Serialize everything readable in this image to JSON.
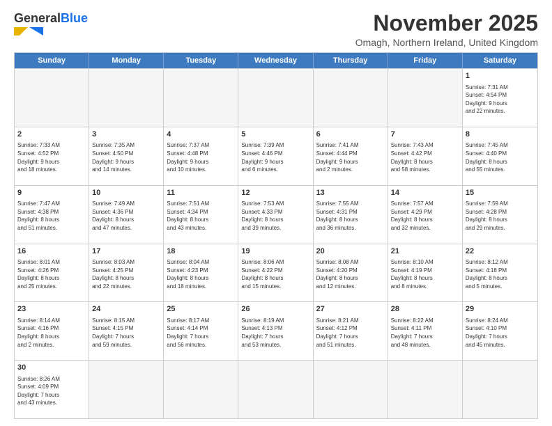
{
  "header": {
    "logo_general": "General",
    "logo_blue": "Blue",
    "title": "November 2025",
    "subtitle": "Omagh, Northern Ireland, United Kingdom"
  },
  "days": [
    "Sunday",
    "Monday",
    "Tuesday",
    "Wednesday",
    "Thursday",
    "Friday",
    "Saturday"
  ],
  "weeks": [
    [
      {
        "day": "",
        "empty": true
      },
      {
        "day": "",
        "empty": true
      },
      {
        "day": "",
        "empty": true
      },
      {
        "day": "",
        "empty": true
      },
      {
        "day": "",
        "empty": true
      },
      {
        "day": "",
        "empty": true
      },
      {
        "day": "1",
        "sunrise": "Sunrise: 7:31 AM",
        "sunset": "Sunset: 4:54 PM",
        "daylight": "Daylight: 9 hours",
        "daylight2": "and 22 minutes."
      }
    ],
    [
      {
        "day": "2",
        "sunrise": "Sunrise: 7:33 AM",
        "sunset": "Sunset: 4:52 PM",
        "daylight": "Daylight: 9 hours",
        "daylight2": "and 18 minutes."
      },
      {
        "day": "3",
        "sunrise": "Sunrise: 7:35 AM",
        "sunset": "Sunset: 4:50 PM",
        "daylight": "Daylight: 9 hours",
        "daylight2": "and 14 minutes."
      },
      {
        "day": "4",
        "sunrise": "Sunrise: 7:37 AM",
        "sunset": "Sunset: 4:48 PM",
        "daylight": "Daylight: 9 hours",
        "daylight2": "and 10 minutes."
      },
      {
        "day": "5",
        "sunrise": "Sunrise: 7:39 AM",
        "sunset": "Sunset: 4:46 PM",
        "daylight": "Daylight: 9 hours",
        "daylight2": "and 6 minutes."
      },
      {
        "day": "6",
        "sunrise": "Sunrise: 7:41 AM",
        "sunset": "Sunset: 4:44 PM",
        "daylight": "Daylight: 9 hours",
        "daylight2": "and 2 minutes."
      },
      {
        "day": "7",
        "sunrise": "Sunrise: 7:43 AM",
        "sunset": "Sunset: 4:42 PM",
        "daylight": "Daylight: 8 hours",
        "daylight2": "and 58 minutes."
      },
      {
        "day": "8",
        "sunrise": "Sunrise: 7:45 AM",
        "sunset": "Sunset: 4:40 PM",
        "daylight": "Daylight: 8 hours",
        "daylight2": "and 55 minutes."
      }
    ],
    [
      {
        "day": "9",
        "sunrise": "Sunrise: 7:47 AM",
        "sunset": "Sunset: 4:38 PM",
        "daylight": "Daylight: 8 hours",
        "daylight2": "and 51 minutes."
      },
      {
        "day": "10",
        "sunrise": "Sunrise: 7:49 AM",
        "sunset": "Sunset: 4:36 PM",
        "daylight": "Daylight: 8 hours",
        "daylight2": "and 47 minutes."
      },
      {
        "day": "11",
        "sunrise": "Sunrise: 7:51 AM",
        "sunset": "Sunset: 4:34 PM",
        "daylight": "Daylight: 8 hours",
        "daylight2": "and 43 minutes."
      },
      {
        "day": "12",
        "sunrise": "Sunrise: 7:53 AM",
        "sunset": "Sunset: 4:33 PM",
        "daylight": "Daylight: 8 hours",
        "daylight2": "and 39 minutes."
      },
      {
        "day": "13",
        "sunrise": "Sunrise: 7:55 AM",
        "sunset": "Sunset: 4:31 PM",
        "daylight": "Daylight: 8 hours",
        "daylight2": "and 36 minutes."
      },
      {
        "day": "14",
        "sunrise": "Sunrise: 7:57 AM",
        "sunset": "Sunset: 4:29 PM",
        "daylight": "Daylight: 8 hours",
        "daylight2": "and 32 minutes."
      },
      {
        "day": "15",
        "sunrise": "Sunrise: 7:59 AM",
        "sunset": "Sunset: 4:28 PM",
        "daylight": "Daylight: 8 hours",
        "daylight2": "and 29 minutes."
      }
    ],
    [
      {
        "day": "16",
        "sunrise": "Sunrise: 8:01 AM",
        "sunset": "Sunset: 4:26 PM",
        "daylight": "Daylight: 8 hours",
        "daylight2": "and 25 minutes."
      },
      {
        "day": "17",
        "sunrise": "Sunrise: 8:03 AM",
        "sunset": "Sunset: 4:25 PM",
        "daylight": "Daylight: 8 hours",
        "daylight2": "and 22 minutes."
      },
      {
        "day": "18",
        "sunrise": "Sunrise: 8:04 AM",
        "sunset": "Sunset: 4:23 PM",
        "daylight": "Daylight: 8 hours",
        "daylight2": "and 18 minutes."
      },
      {
        "day": "19",
        "sunrise": "Sunrise: 8:06 AM",
        "sunset": "Sunset: 4:22 PM",
        "daylight": "Daylight: 8 hours",
        "daylight2": "and 15 minutes."
      },
      {
        "day": "20",
        "sunrise": "Sunrise: 8:08 AM",
        "sunset": "Sunset: 4:20 PM",
        "daylight": "Daylight: 8 hours",
        "daylight2": "and 12 minutes."
      },
      {
        "day": "21",
        "sunrise": "Sunrise: 8:10 AM",
        "sunset": "Sunset: 4:19 PM",
        "daylight": "Daylight: 8 hours",
        "daylight2": "and 8 minutes."
      },
      {
        "day": "22",
        "sunrise": "Sunrise: 8:12 AM",
        "sunset": "Sunset: 4:18 PM",
        "daylight": "Daylight: 8 hours",
        "daylight2": "and 5 minutes."
      }
    ],
    [
      {
        "day": "23",
        "sunrise": "Sunrise: 8:14 AM",
        "sunset": "Sunset: 4:16 PM",
        "daylight": "Daylight: 8 hours",
        "daylight2": "and 2 minutes."
      },
      {
        "day": "24",
        "sunrise": "Sunrise: 8:15 AM",
        "sunset": "Sunset: 4:15 PM",
        "daylight": "Daylight: 7 hours",
        "daylight2": "and 59 minutes."
      },
      {
        "day": "25",
        "sunrise": "Sunrise: 8:17 AM",
        "sunset": "Sunset: 4:14 PM",
        "daylight": "Daylight: 7 hours",
        "daylight2": "and 56 minutes."
      },
      {
        "day": "26",
        "sunrise": "Sunrise: 8:19 AM",
        "sunset": "Sunset: 4:13 PM",
        "daylight": "Daylight: 7 hours",
        "daylight2": "and 53 minutes."
      },
      {
        "day": "27",
        "sunrise": "Sunrise: 8:21 AM",
        "sunset": "Sunset: 4:12 PM",
        "daylight": "Daylight: 7 hours",
        "daylight2": "and 51 minutes."
      },
      {
        "day": "28",
        "sunrise": "Sunrise: 8:22 AM",
        "sunset": "Sunset: 4:11 PM",
        "daylight": "Daylight: 7 hours",
        "daylight2": "and 48 minutes."
      },
      {
        "day": "29",
        "sunrise": "Sunrise: 8:24 AM",
        "sunset": "Sunset: 4:10 PM",
        "daylight": "Daylight: 7 hours",
        "daylight2": "and 45 minutes."
      }
    ],
    [
      {
        "day": "30",
        "sunrise": "Sunrise: 8:26 AM",
        "sunset": "Sunset: 4:09 PM",
        "daylight": "Daylight: 7 hours",
        "daylight2": "and 43 minutes."
      },
      {
        "day": "",
        "empty": true
      },
      {
        "day": "",
        "empty": true
      },
      {
        "day": "",
        "empty": true
      },
      {
        "day": "",
        "empty": true
      },
      {
        "day": "",
        "empty": true
      },
      {
        "day": "",
        "empty": true
      }
    ]
  ]
}
